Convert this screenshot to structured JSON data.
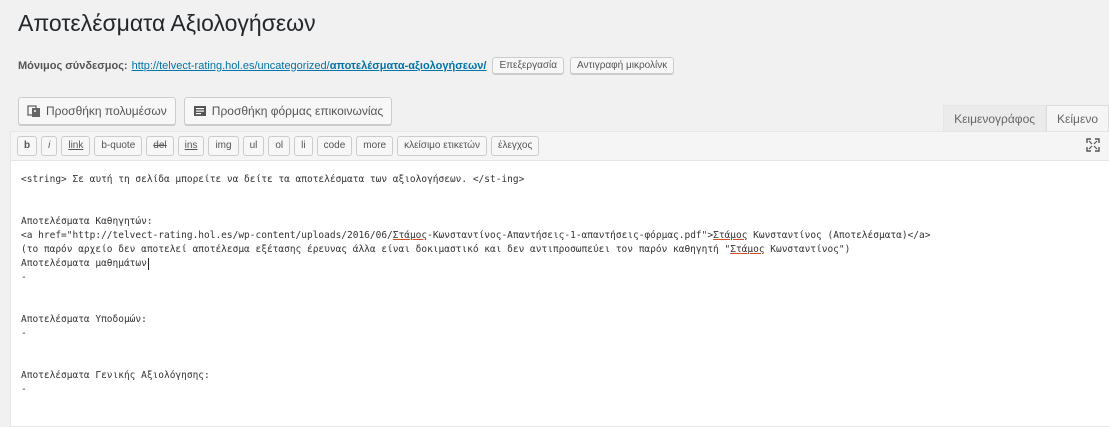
{
  "page": {
    "title": "Αποτελέσματα Αξιολογήσεων"
  },
  "permalink": {
    "label": "Μόνιμος σύνδεσμος:",
    "url_base": "http://telvect-rating.hol.es/uncategorized/",
    "url_slug": "αποτελέσματα-αξιολογήσεων/",
    "edit_button": "Επεξεργασία",
    "copy_button": "Αντιγραφή μικρολίνκ"
  },
  "media_buttons": {
    "add_media": "Προσθήκη πολυμέσων",
    "add_form": "Προσθήκη φόρμας επικοινωνίας"
  },
  "editor_tabs": {
    "visual": "Κειμενογράφος",
    "text": "Κείμενο"
  },
  "quicktags": [
    "b",
    "i",
    "link",
    "b-quote",
    "del",
    "ins",
    "img",
    "ul",
    "ol",
    "li",
    "code",
    "more",
    "κλείσιμο ετικετών",
    "έλεγχος"
  ],
  "content": {
    "line1": "<string> Σε αυτή τη σελίδα μπορείτε να δείτε τα αποτελέσματα των αξιολογήσεων. </st-ing>",
    "section1_title": "Αποτελέσματα Καθηγητών:",
    "link_line_a": "<a href=\"http://telvect-rating.hol.es/wp-content/uploads/2016/06/",
    "link_line_b": "Στάμος",
    "link_line_c": "-Κωνσταντίνος-Απαντήσεις-1-απαντήσεις-φόρμας.pdf\">",
    "link_line_d": "Στάμος",
    "link_line_e": " Κωνσταντίνος (Αποτελέσματα)</a>",
    "note_line_a": "(το παρόν αρχείο δεν αποτελεί αποτέλεσμα εξέτασης έρευνας άλλα είναι δοκιμαστικό και δεν αντιπροσωπεύει τον παρόν καθηγητή \"",
    "note_line_b": "Στάμος",
    "note_line_c": " Κωνσταντίνος\")",
    "students_line": "Αποτελέσματα μαθημάτων",
    "dash1": "-",
    "section2_title": "Αποτελέσματα Υποδομών:",
    "dash2": "-",
    "section3_title": "Αποτελέσματα Γενικής Αξιολόγησης:",
    "dash3": "-"
  },
  "colors": {
    "link": "#0073aa",
    "background": "#f1f1f1"
  }
}
